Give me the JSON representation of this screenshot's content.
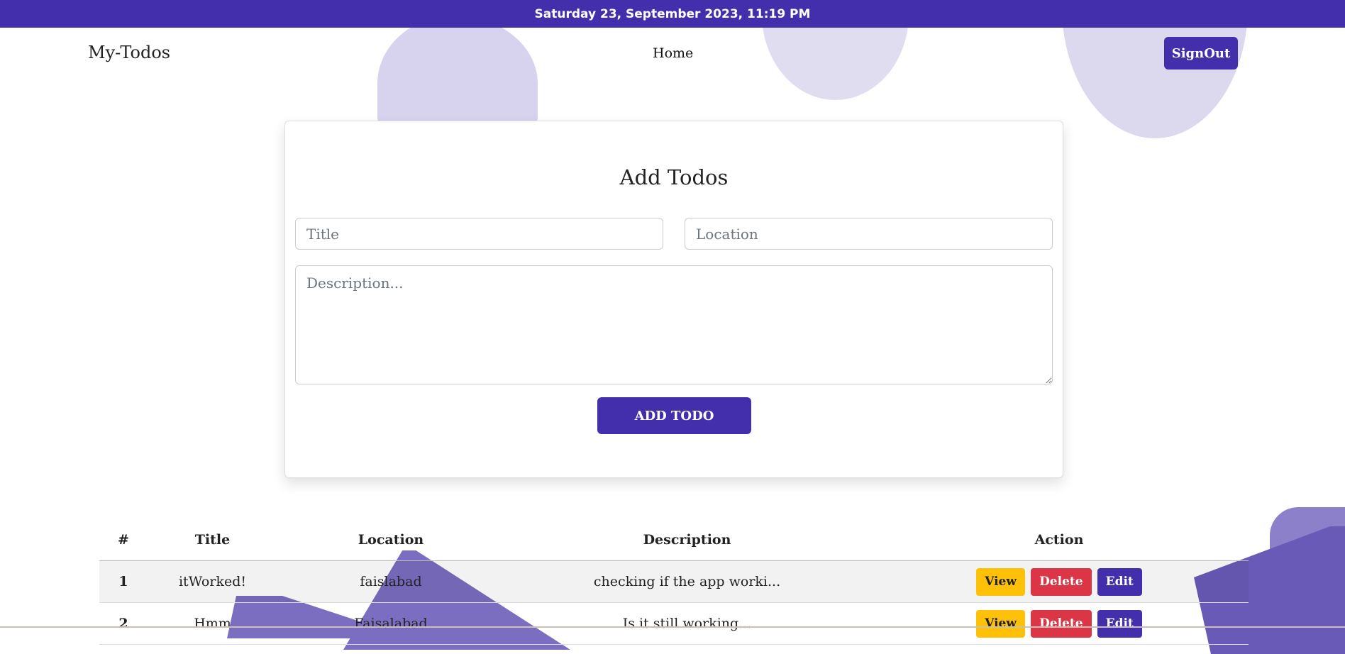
{
  "topbar": {
    "datetime": "Saturday 23, September 2023, 11:19 PM"
  },
  "nav": {
    "brand": "My-Todos",
    "home": "Home",
    "signout": "SignOut"
  },
  "form": {
    "heading": "Add Todos",
    "title_placeholder": "Title",
    "location_placeholder": "Location",
    "description_placeholder": "Description...",
    "submit_label": "ADD TODO"
  },
  "table": {
    "headers": [
      "#",
      "Title",
      "Location",
      "Description",
      "Action"
    ],
    "rows": [
      {
        "num": "1",
        "title": "itWorked!",
        "location": "faislabad",
        "description": "checking if the app worki..."
      },
      {
        "num": "2",
        "title": "Hmm",
        "location": "Faisalabad",
        "description": "Is it still working..."
      }
    ],
    "actions": {
      "view": "View",
      "delete": "Delete",
      "edit": "Edit"
    }
  },
  "colors": {
    "brand": "#432fab",
    "view": "#ffc107",
    "delete": "#dc3545"
  }
}
